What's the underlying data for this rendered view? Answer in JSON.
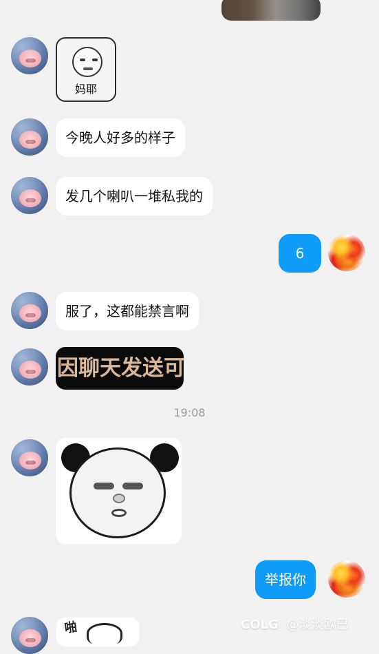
{
  "chat": {
    "messages": [
      {
        "type": "text",
        "side": "left",
        "text": "今晚人好多的样子"
      },
      {
        "type": "text",
        "side": "left",
        "text": "发几个喇叭一堆私我的"
      },
      {
        "type": "text",
        "side": "right",
        "text": "6"
      },
      {
        "type": "text",
        "side": "left",
        "text": "服了，这都能禁言啊"
      },
      {
        "type": "image",
        "side": "left",
        "overlay_text": "因聊天发送可"
      },
      {
        "type": "time",
        "text": "19:08"
      },
      {
        "type": "image",
        "side": "left",
        "description": "panda-face-sticker"
      },
      {
        "type": "text",
        "side": "right",
        "text": "举报你"
      },
      {
        "type": "image",
        "side": "left",
        "overlay_text": "啪"
      }
    ],
    "stickers": {
      "top_left_sticker_caption": "妈耶"
    }
  },
  "watermark": {
    "logo": "COLG",
    "handle": "@淡淡欧巴"
  }
}
